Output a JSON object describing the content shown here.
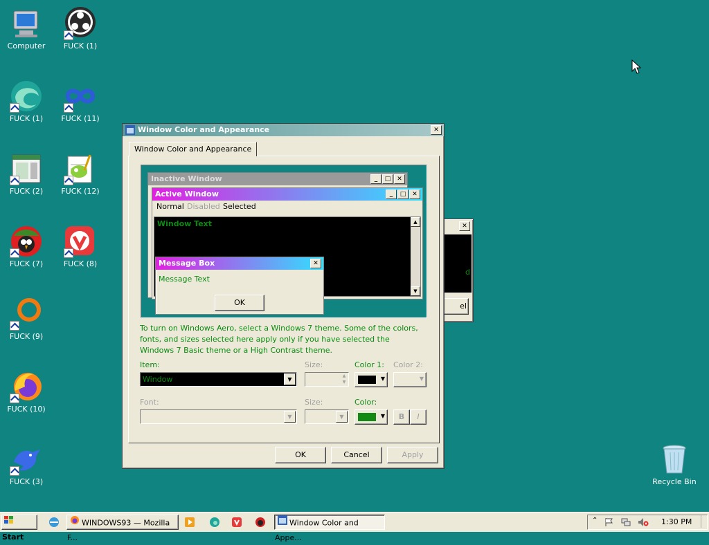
{
  "desktop": {
    "icons": [
      {
        "label": "Computer"
      },
      {
        "label": "FUCK (1)"
      },
      {
        "label": "FUCK (1)"
      },
      {
        "label": "FUCK (11)"
      },
      {
        "label": "FUCK (2)"
      },
      {
        "label": "FUCK (12)"
      },
      {
        "label": "FUCK (7)"
      },
      {
        "label": "FUCK (8)"
      },
      {
        "label": "FUCK (9)"
      },
      {
        "label": "FUCK (10)"
      },
      {
        "label": "FUCK (3)"
      },
      {
        "label": "Recycle Bin"
      }
    ]
  },
  "dialog": {
    "title": "Window Color and Appearance",
    "tab": "Window Color and Appearance",
    "preview": {
      "inactive_title": "Inactive Window",
      "active_title": "Active Window",
      "menu_normal": "Normal",
      "menu_disabled": "Disabled",
      "menu_selected": "Selected",
      "window_text": "Window Text",
      "msgbox_title": "Message Box",
      "msgbox_text": "Message Text",
      "msgbox_ok": "OK"
    },
    "info_text": "To turn on Windows Aero, select a Windows 7 theme.  Some of the colors, fonts, and sizes selected here apply only if you have selected the Windows 7 Basic theme or a High Contrast theme.",
    "item_label": "Item:",
    "item_value": "Window",
    "size_label": "Size:",
    "color1_label": "Color 1:",
    "color2_label": "Color 2:",
    "font_label": "Font:",
    "size2_label": "Size:",
    "color_label": "Color:",
    "bold_label": "B",
    "italic_label": "I",
    "ok": "OK",
    "cancel": "Cancel",
    "apply": "Apply"
  },
  "background_window": {
    "partial_text": "el",
    "partial_letter": "d"
  },
  "taskbar": {
    "start": "Start",
    "firefox_item": "WINDOWS93 — Mozilla F...",
    "dialog_item": "Window Color and Appe...",
    "clock": "1:30 PM"
  },
  "colors": {
    "desktop": "#0f8480",
    "window_text": "#0b8a12",
    "color1_swatch": "#000000",
    "color_swatch": "#138a13",
    "active_gradient_start": "#e020e0",
    "active_gradient_end": "#30e0ff"
  }
}
